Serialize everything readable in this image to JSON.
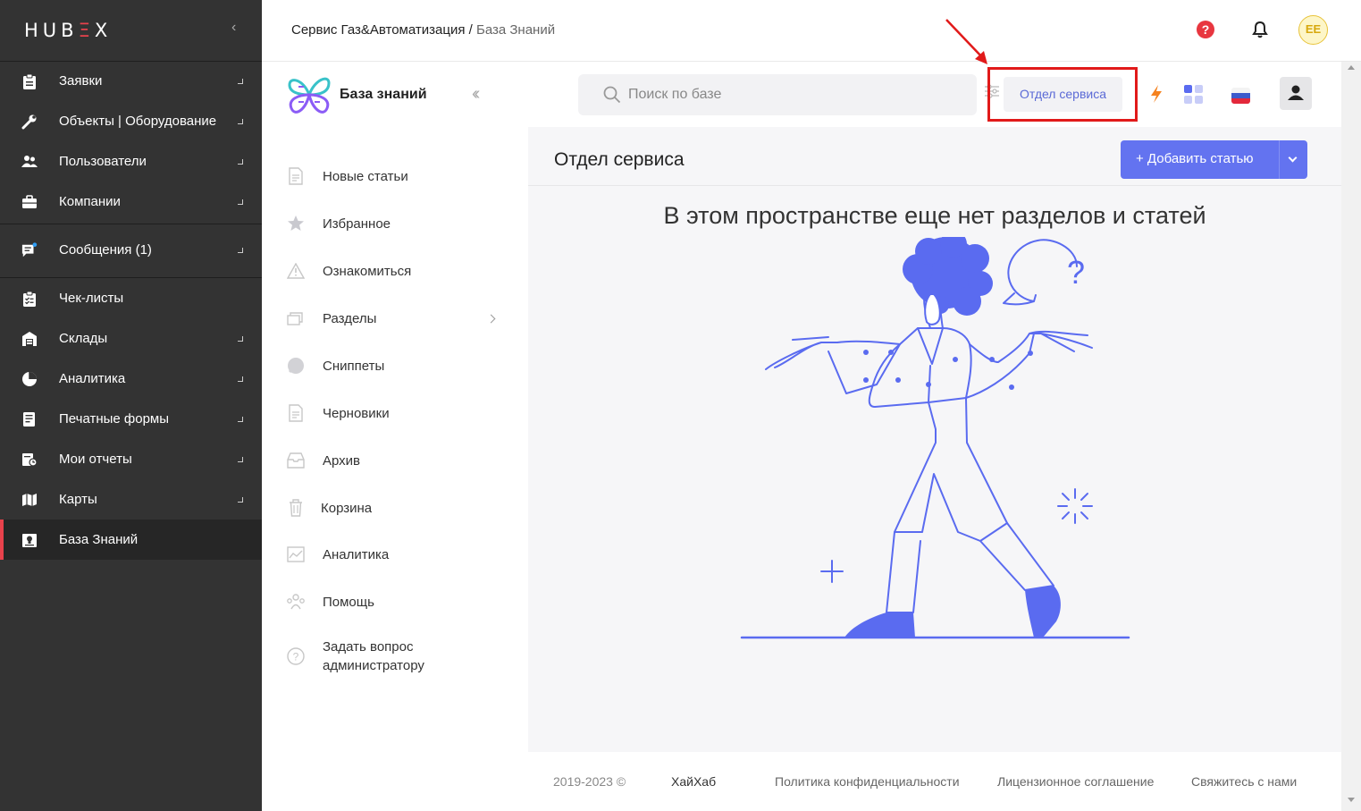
{
  "app": {
    "logo_text": "HUBEX"
  },
  "header": {
    "breadcrumb_main": "Сервис Газ&Автоматизация",
    "breadcrumb_sep": " / ",
    "breadcrumb_sub": "База Знаний",
    "help_glyph": "?",
    "avatar_initials": "EE"
  },
  "sidebar": {
    "items": [
      {
        "label": "Заявки",
        "icon": "clipboard-icon"
      },
      {
        "label": "Объекты | Оборудование",
        "icon": "wrench-icon"
      },
      {
        "label": "Пользователи",
        "icon": "users-icon"
      },
      {
        "label": "Компании",
        "icon": "briefcase-icon"
      },
      {
        "label": "Сообщения (1)",
        "icon": "message-icon"
      },
      {
        "label": "Чек-листы",
        "icon": "checklist-icon"
      },
      {
        "label": "Склады",
        "icon": "warehouse-icon"
      },
      {
        "label": "Аналитика",
        "icon": "pie-chart-icon"
      },
      {
        "label": "Печатные формы",
        "icon": "print-form-icon"
      },
      {
        "label": "Мои отчеты",
        "icon": "reports-icon"
      },
      {
        "label": "Карты",
        "icon": "map-icon"
      },
      {
        "label": "База Знаний",
        "icon": "knowledge-icon"
      }
    ]
  },
  "kb_menu": {
    "title": "База знаний",
    "items": [
      {
        "label": "Новые статьи"
      },
      {
        "label": "Избранное"
      },
      {
        "label": "Ознакомиться"
      },
      {
        "label": "Разделы"
      },
      {
        "label": "Сниппеты"
      },
      {
        "label": "Черновики"
      },
      {
        "label": "Архив"
      },
      {
        "label": "Корзина"
      },
      {
        "label": "Аналитика"
      },
      {
        "label": "Помощь"
      },
      {
        "label": "Задать вопрос администратору"
      }
    ]
  },
  "toolbar": {
    "search_placeholder": "Поиск по базе",
    "dept_button": "Отдел сервиса"
  },
  "content": {
    "section_title": "Отдел сервиса",
    "add_button": "+  Добавить статью",
    "empty_message": "В этом пространстве еще нет разделов и статей"
  },
  "footer": {
    "copyright": "2019-2023 ©",
    "brand": "ХайХаб",
    "links": [
      "Политика конфиденциальности",
      "Лицензионное соглашение",
      "Свяжитесь с нами"
    ]
  },
  "colors": {
    "accent": "#6373f0",
    "sidebar_bg": "#333333",
    "active_marker": "#e8424c",
    "annotation": "#e11a1a"
  }
}
